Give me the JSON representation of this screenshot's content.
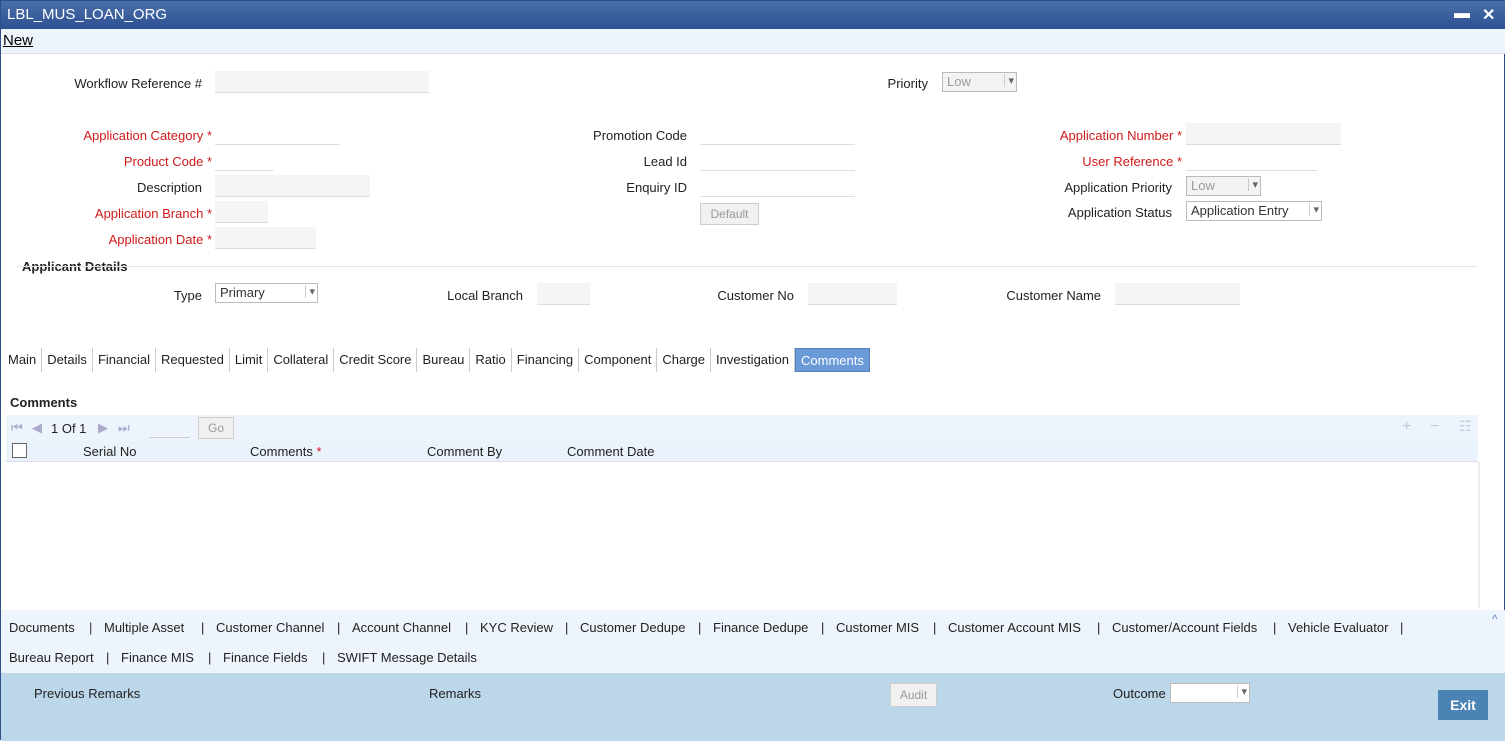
{
  "window": {
    "title": "LBL_MUS_LOAN_ORG",
    "minimize": "▬",
    "close": "✕"
  },
  "menu": {
    "new": "New"
  },
  "header": {
    "workflow_ref": "Workflow Reference #",
    "priority": "Priority",
    "priority_value": "Low"
  },
  "form": {
    "app_category": "Application Category",
    "product_code": "Product Code",
    "description": "Description",
    "app_branch": "Application Branch",
    "app_date": "Application Date",
    "promotion_code": "Promotion Code",
    "lead_id": "Lead Id",
    "enquiry_id": "Enquiry ID",
    "default_btn": "Default",
    "app_number": "Application Number",
    "user_reference": "User Reference",
    "app_priority": "Application Priority",
    "app_priority_value": "Low",
    "app_status": "Application Status",
    "app_status_value": "Application Entry",
    "star": "*"
  },
  "applicant": {
    "title": "Applicant Details",
    "type": "Type",
    "type_value": "Primary",
    "local_branch": "Local Branch",
    "customer_no": "Customer No",
    "customer_name": "Customer Name"
  },
  "tabs": [
    "Main",
    "Details",
    "Financial",
    "Requested",
    "Limit",
    "Collateral",
    "Credit Score",
    "Bureau",
    "Ratio",
    "Financing",
    "Component",
    "Charge",
    "Investigation",
    "Comments"
  ],
  "comments": {
    "title": "Comments",
    "page": "1 Of 1",
    "go": "Go",
    "columns": [
      "Serial No",
      "Comments",
      "Comment By",
      "Comment Date"
    ]
  },
  "links_row1": [
    "Documents",
    "Multiple Asset",
    "Customer Channel",
    "Account Channel",
    "KYC Review",
    "Customer Dedupe",
    "Finance Dedupe",
    "Customer MIS",
    "Customer Account MIS",
    "Customer/Account Fields",
    "Vehicle Evaluator"
  ],
  "links_row2": [
    "Bureau Report",
    "Finance MIS",
    "Finance Fields",
    "SWIFT Message Details"
  ],
  "footer": {
    "previous_remarks": "Previous Remarks",
    "remarks": "Remarks",
    "audit": "Audit",
    "outcome": "Outcome",
    "exit": "Exit"
  }
}
